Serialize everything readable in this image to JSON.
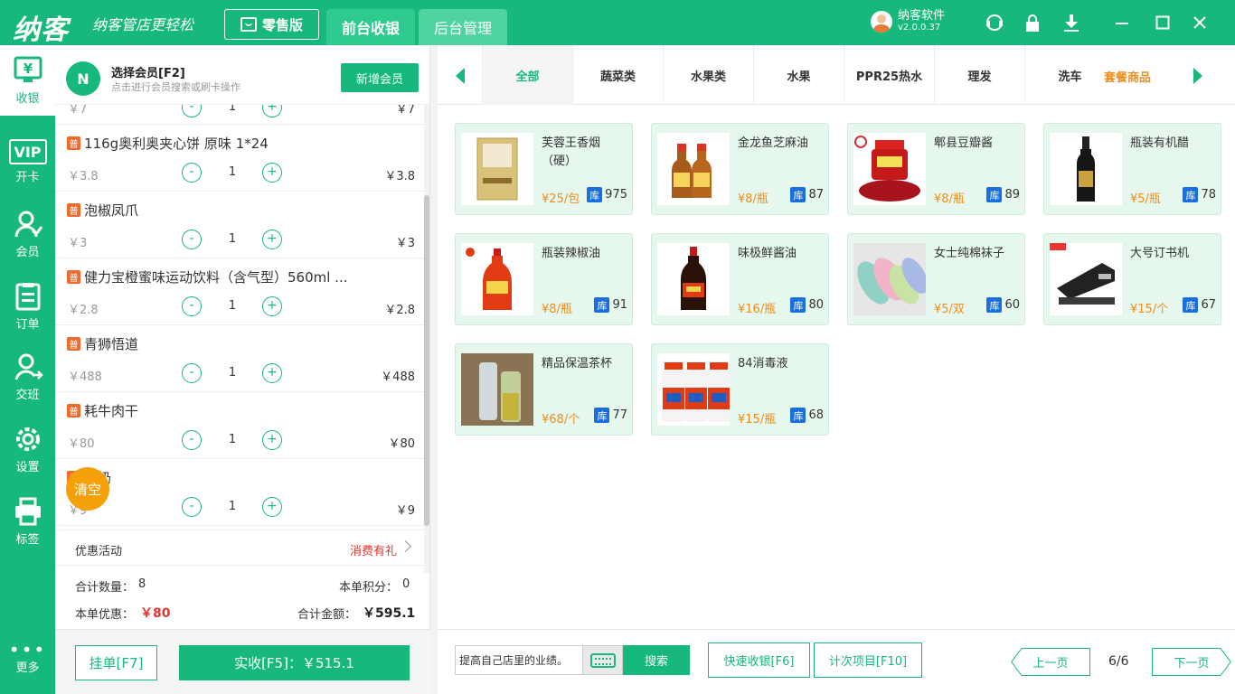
{
  "titlebar": {
    "logo": "纳客",
    "slogan": "纳客管店更轻松",
    "edition": "零售版",
    "tabs": [
      "前台收银",
      "后台管理"
    ],
    "user_name": "纳客软件",
    "version": "v2.0.0.37"
  },
  "sidebar": {
    "items": [
      {
        "label": "收银",
        "icon": "cashier-icon",
        "glyph": "¥"
      },
      {
        "label": "开卡",
        "icon": "vip-card-icon",
        "glyph": "VIP"
      },
      {
        "label": "会员",
        "icon": "member-icon",
        "glyph": "☺"
      },
      {
        "label": "订单",
        "icon": "order-icon",
        "glyph": "☰"
      },
      {
        "label": "交班",
        "icon": "shift-icon",
        "glyph": "⇄"
      },
      {
        "label": "设置",
        "icon": "settings-icon",
        "glyph": "⚙"
      },
      {
        "label": "标签",
        "icon": "printer-icon",
        "glyph": "⎙"
      }
    ],
    "more_label": "更多",
    "more_glyph": "•••"
  },
  "member": {
    "title": "选择会员[F2]",
    "hint": "点击进行会员搜索或刷卡操作",
    "new_button": "新增会员",
    "icon_glyph": "N"
  },
  "cart": {
    "partial_row": {
      "price": "￥7",
      "qty": "1",
      "total": "￥7"
    },
    "items": [
      {
        "badge": "普",
        "name": "116g奥利奥夹心饼 原味 1*24",
        "price": "￥3.8",
        "qty": "1",
        "total": "￥3.8"
      },
      {
        "badge": "普",
        "name": "泡椒凤爪",
        "price": "￥3",
        "qty": "1",
        "total": "￥3"
      },
      {
        "badge": "普",
        "name": "健力宝橙蜜味运动饮料（含气型）560ml ...",
        "price": "￥2.8",
        "qty": "1",
        "total": "￥2.8"
      },
      {
        "badge": "普",
        "name": "青狮悟道",
        "price": "￥488",
        "qty": "1",
        "total": "￥488"
      },
      {
        "badge": "普",
        "name": "耗牛肉干",
        "price": "￥80",
        "qty": "1",
        "total": "￥80"
      },
      {
        "badge": "普",
        "name": "酸奶",
        "price": "￥9",
        "qty": "1",
        "total": "￥9"
      }
    ],
    "minus": "-",
    "plus": "+",
    "clear_label": "清空",
    "promo_label": "优惠活动",
    "promo_value": "消费有礼",
    "total_qty_label": "合计数量：",
    "total_qty": "8",
    "points_label": "本单积分：",
    "points": "0",
    "discount_label": "本单优惠：",
    "discount": "￥80",
    "amount_label": "合计金额：",
    "amount": "￥595.1",
    "hang_button": "挂单[F7]",
    "pay_button": "实收[F5]：￥515.1"
  },
  "categories": {
    "tabs": [
      "全部",
      "蔬菜类",
      "水果类",
      "水果",
      "PPR25热水",
      "理发",
      "洗车"
    ],
    "extra": "套餐商品"
  },
  "products": [
    {
      "name": "芙蓉王香烟（硬）",
      "price": "¥25/包",
      "stock": "975",
      "img": "cigarette"
    },
    {
      "name": "金龙鱼芝麻油",
      "price": "¥8/瓶",
      "stock": "87",
      "img": "sesame-oil"
    },
    {
      "name": "郫县豆瓣酱",
      "price": "¥8/瓶",
      "stock": "89",
      "img": "bean-paste"
    },
    {
      "name": "瓶装有机醋",
      "price": "¥5/瓶",
      "stock": "78",
      "img": "vinegar"
    },
    {
      "name": "瓶装辣椒油",
      "price": "¥8/瓶",
      "stock": "91",
      "img": "chili-oil"
    },
    {
      "name": "味极鲜酱油",
      "price": "¥16/瓶",
      "stock": "80",
      "img": "soy-sauce"
    },
    {
      "name": "女士纯棉袜子",
      "price": "¥5/双",
      "stock": "60",
      "img": "socks"
    },
    {
      "name": "大号订书机",
      "price": "¥15/个",
      "stock": "67",
      "img": "stapler"
    },
    {
      "name": "精品保温茶杯",
      "price": "¥68/个",
      "stock": "77",
      "img": "tea-cup"
    },
    {
      "name": "84消毒液",
      "price": "¥15/瓶",
      "stock": "68",
      "img": "disinfectant"
    }
  ],
  "stock_badge": "库",
  "footer": {
    "search_value": "提高自己店里的业绩。",
    "search_button": "搜索",
    "quick_button": "快速收银[F6]",
    "count_button": "计次项目[F10]",
    "prev_button": "上一页",
    "page": "6/6",
    "next_button": "下一页"
  },
  "colors": {
    "accent": "#16b97b",
    "orange": "#ef8d1b",
    "red": "#e8342e",
    "stock_blue": "#1a6fe0"
  }
}
